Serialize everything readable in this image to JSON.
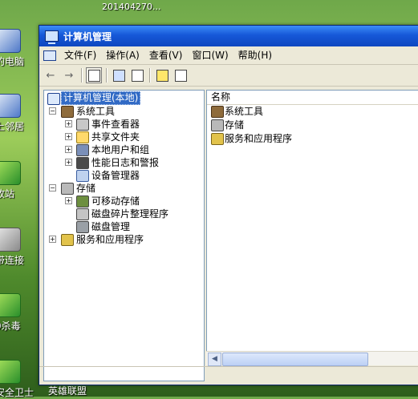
{
  "desktop": {
    "top_text": "201404270...",
    "icons": [
      {
        "label": "的电脑"
      },
      {
        "label": "上邻居"
      },
      {
        "label": "收站"
      },
      {
        "label": "带连接"
      },
      {
        "label": "0杀毒"
      },
      {
        "label": "安全卫士"
      }
    ],
    "taskbar_text": "英雄联盟"
  },
  "window": {
    "title": "计算机管理",
    "menu": [
      "文件(F)",
      "操作(A)",
      "查看(V)",
      "窗口(W)",
      "帮助(H)"
    ],
    "tree": {
      "root": "计算机管理(本地)",
      "system_tools": "系统工具",
      "event_viewer": "事件查看器",
      "shared_folders": "共享文件夹",
      "local_users": "本地用户和组",
      "perf_logs": "性能日志和警报",
      "device_manager": "设备管理器",
      "storage": "存储",
      "removable_storage": "可移动存储",
      "defrag": "磁盘碎片整理程序",
      "disk_mgmt": "磁盘管理",
      "services": "服务和应用程序"
    },
    "list": {
      "column_name": "名称",
      "items": [
        "系统工具",
        "存储",
        "服务和应用程序"
      ]
    }
  },
  "colors": {
    "titlebar": "#1658d8",
    "selection": "#316ac5",
    "window_bg": "#ece9d8"
  }
}
